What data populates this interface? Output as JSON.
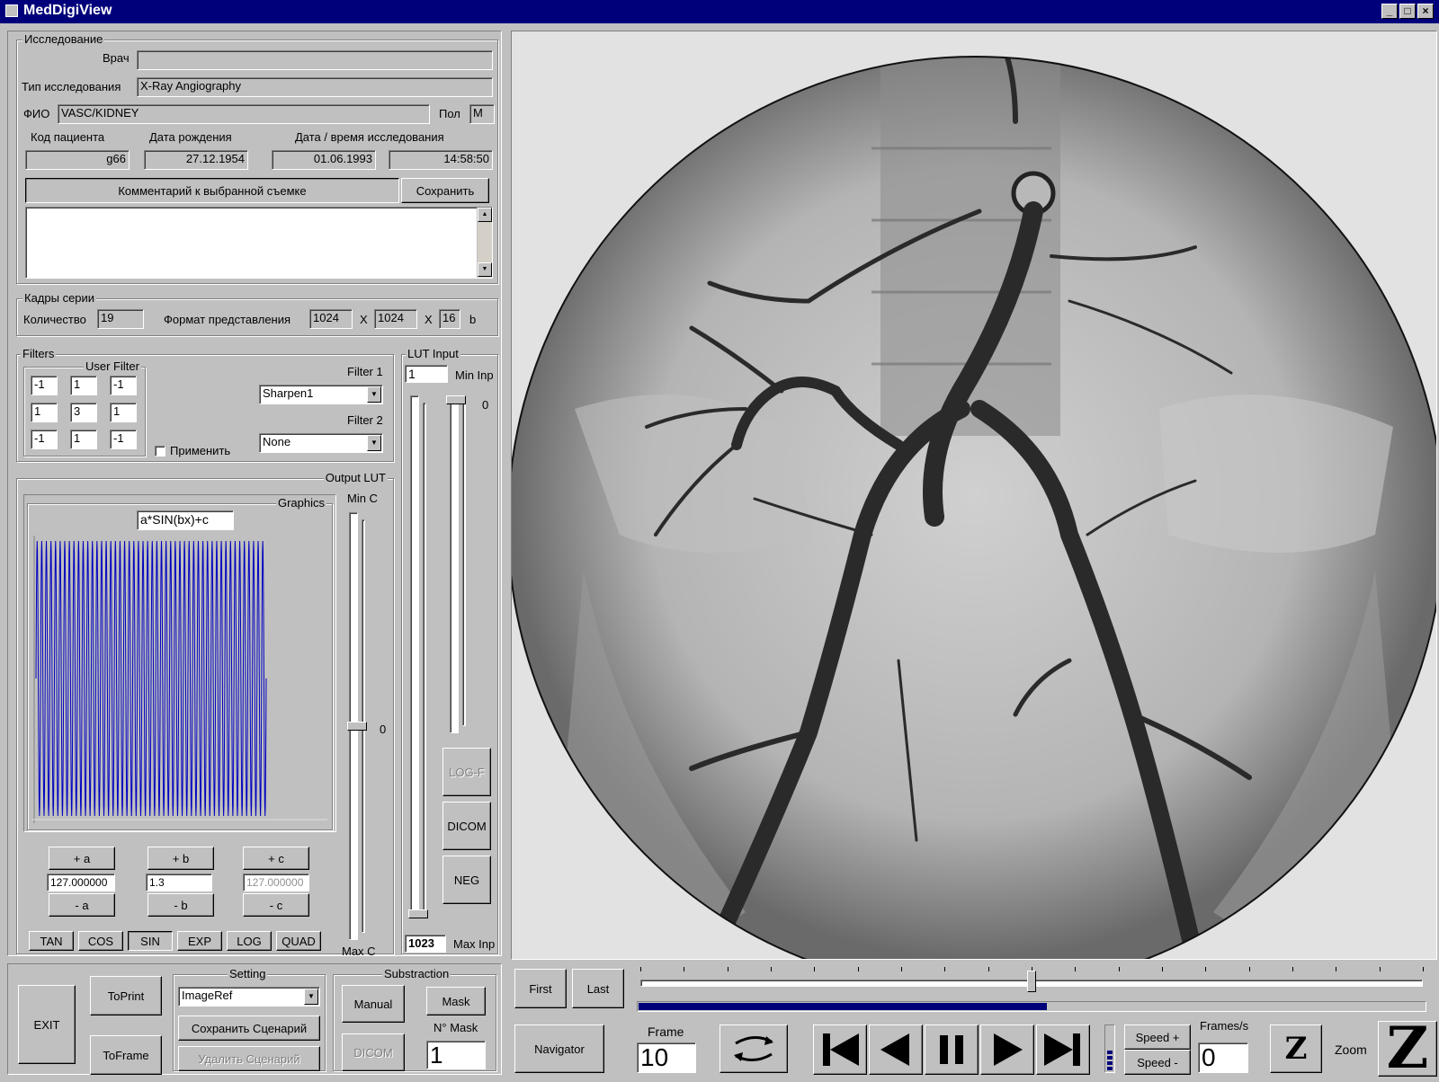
{
  "window": {
    "title": "MedDigiView",
    "minimize": "_",
    "maximize": "□",
    "close": "×"
  },
  "study": {
    "group_label": "Исследование",
    "doctor_label": "Врач",
    "doctor_value": "",
    "type_label": "Тип исследования",
    "type_value": "X-Ray Angiography",
    "name_label": "ФИО",
    "name_value": "VASC/KIDNEY",
    "sex_label": "Пол",
    "sex_value": "M",
    "patient_code_label": "Код пациента",
    "patient_code_value": "g66",
    "birth_label": "Дата рождения",
    "birth_value": "27.12.1954",
    "datetime_label": "Дата / время исследования",
    "date_value": "01.06.1993",
    "time_value": "14:58:50",
    "comment_label": "Комментарий к выбранной съемке",
    "save_label": "Сохранить",
    "comment_value": ""
  },
  "series": {
    "group_label": "Кадры серии",
    "count_label": "Количество",
    "count_value": "19",
    "format_label": "Формат представления",
    "width_value": "1024",
    "x1": "X",
    "height_value": "1024",
    "x2": "X",
    "bits_value": "16",
    "bits_unit": "b"
  },
  "filters": {
    "group_label": "Filters",
    "user_filter_label": "User Filter",
    "kernel": [
      "-1",
      "1",
      "-1",
      "1",
      "3",
      "1",
      "-1",
      "1",
      "-1"
    ],
    "apply_label": "Применить",
    "filter1_label": "Filter 1",
    "filter1_value": "Sharpen1",
    "filter2_label": "Filter 2",
    "filter2_value": "None"
  },
  "lut_input": {
    "group_label": "LUT Input",
    "min_value": "1",
    "min_label": "Min Inp",
    "zero_label": "0",
    "max_value": "1023",
    "max_label": "Max Inp",
    "logf_label": "LOG-F",
    "dicom_label": "DICOM",
    "neg_label": "NEG",
    "min_slider_level": 0.0,
    "max_slider_level": 1.0
  },
  "output_lut": {
    "group_label": "Output LUT",
    "graphics_label": "Graphics",
    "formula": "a*SIN(bx)+c",
    "minc_label": "Min C",
    "maxc_label": "Max C",
    "zero_label": "0",
    "plus_a": "+ a",
    "plus_b": "+ b",
    "plus_c": "+ c",
    "a_value": "127.000000",
    "b_value": "1.3",
    "c_value": "127.000000",
    "minus_a": "- a",
    "minus_b": "- b",
    "minus_c": "- c",
    "functions": [
      "TAN",
      "COS",
      "SIN",
      "EXP",
      "LOG",
      "QUAD"
    ],
    "active_function": "SIN",
    "wave_color": "#0000c0",
    "c_slider_level": 0.5
  },
  "bottom_left": {
    "exit_label": "EXIT",
    "toprint_label": "ToPrint",
    "toframe_label": "ToFrame",
    "setting_label": "Setting",
    "setting_value": "ImageRef",
    "save_scenario_label": "Сохранить Сценарий",
    "delete_scenario_label": "Удалить Сценарий",
    "subtraction_label": "Substraction",
    "manual_label": "Manual",
    "mask_label": "Mask",
    "dicom_label": "DICOM",
    "nmask_label": "N° Mask",
    "nmask_value": "1"
  },
  "player": {
    "first_label": "First",
    "last_label": "Last",
    "timeline_level": 0.5,
    "progress_level": 0.52,
    "progress_color": "#00007b",
    "navigator_label": "Navigator",
    "frame_label": "Frame",
    "frame_value": "10",
    "speed_plus": "Speed +",
    "speed_minus": "Speed -",
    "fps_label": "Frames/s",
    "fps_value": "0",
    "zoom_label": "Zoom",
    "z_small": "Z",
    "z_big": "Z"
  }
}
